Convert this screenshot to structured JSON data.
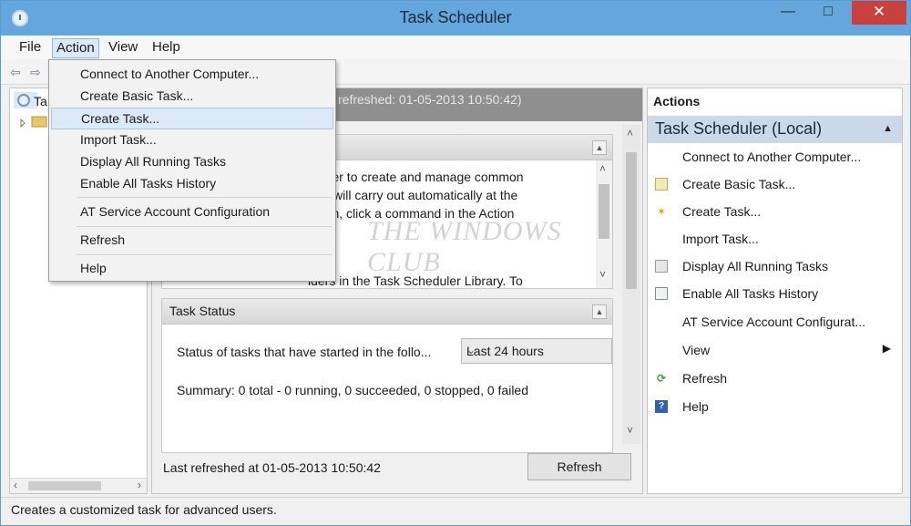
{
  "window": {
    "title": "Task Scheduler",
    "minimize": "—",
    "maximize": "□",
    "close": "✕"
  },
  "menubar": {
    "file": "File",
    "action": "Action",
    "view": "View",
    "help": "Help"
  },
  "toolbar": {
    "back": "⇦",
    "forward": "⇨"
  },
  "tree": {
    "root_label": "Ta"
  },
  "action_menu": {
    "items": [
      "Connect to Another Computer...",
      "Create Basic Task...",
      "Create Task...",
      "Import Task...",
      "Display All Running Tasks",
      "Enable All Tasks History",
      "AT Service Account Configuration",
      "Refresh",
      "Help"
    ],
    "highlighted_index": 2
  },
  "center": {
    "header_text": "refreshed: 01-05-2013 10:50:42)",
    "overview_lines": [
      "eduler to create and manage common",
      "uter will carry out automatically at the",
      "begin, click a command in the Action"
    ],
    "overview_line4": "lders in the Task Scheduler Library. To",
    "task_status": {
      "title": "Task Status",
      "filter_label": "Status of tasks that have started in the follo...",
      "filter_value": "Last 24 hours",
      "summary": "Summary: 0 total - 0 running, 0 succeeded, 0 stopped, 0 failed"
    },
    "watermark": "THE WINDOWS CLUB",
    "last_refreshed": "Last refreshed at 01-05-2013 10:50:42",
    "refresh_button": "Refresh"
  },
  "actions": {
    "title": "Actions",
    "group": "Task Scheduler (Local)",
    "items": [
      {
        "label": "Connect to Another Computer...",
        "icon": ""
      },
      {
        "label": "Create Basic Task...",
        "icon": "create-basic-task-icon"
      },
      {
        "label": "Create Task...",
        "icon": "create-task-icon"
      },
      {
        "label": "Import Task...",
        "icon": ""
      },
      {
        "label": "Display All Running Tasks",
        "icon": "running-tasks-icon"
      },
      {
        "label": "Enable All Tasks History",
        "icon": "history-icon"
      },
      {
        "label": "AT Service Account Configurat...",
        "icon": ""
      },
      {
        "label": "View",
        "icon": ""
      },
      {
        "label": "Refresh",
        "icon": "refresh-icon"
      },
      {
        "label": "Help",
        "icon": "help-icon"
      }
    ]
  },
  "statusbar": {
    "text": "Creates a customized task for advanced users."
  },
  "colors": {
    "titlebar": "#65a6dd",
    "close": "#c9413f",
    "actions_group": "#c9d9e9",
    "menu_highlight": "#dce9f6"
  }
}
